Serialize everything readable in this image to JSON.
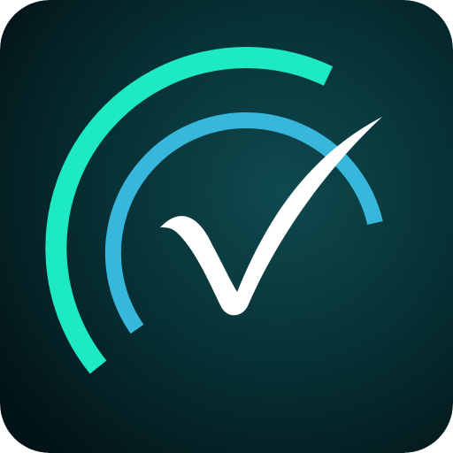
{
  "app_icon": {
    "icon_name": "checkmark-with-signal-arcs-icon",
    "colors": {
      "background_light": "#0f4a4f",
      "background_mid": "#062f33",
      "background_dark": "#031417",
      "outer_arc": "#1de9c3",
      "inner_arc": "#38b7dc",
      "checkmark": "#ffffff"
    }
  }
}
